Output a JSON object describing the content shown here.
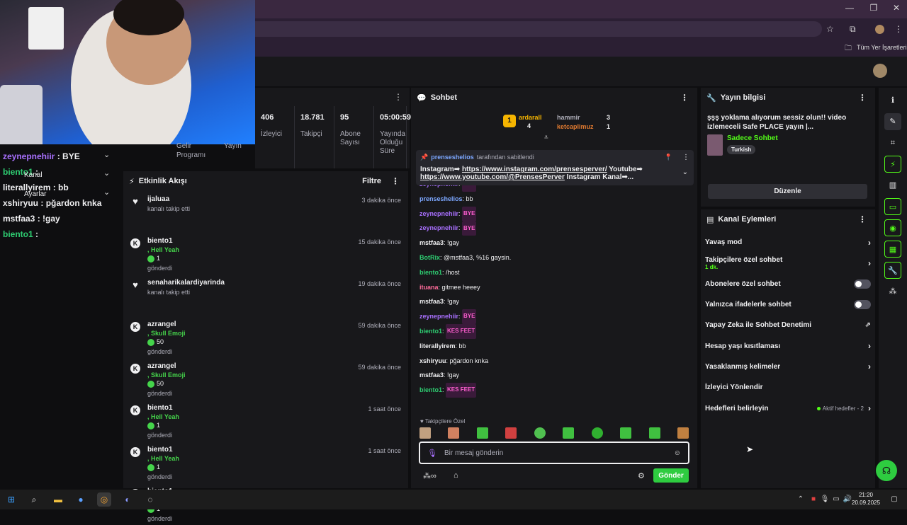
{
  "browser": {
    "bookmarks_label": "Tüm Yer İşaretleri"
  },
  "left_chat": [
    {
      "user": "zeynepnehiir",
      "msg": "BYE",
      "color": "#a970ff"
    },
    {
      "user": "biento1",
      "msg": "",
      "color": "#2ecc71"
    },
    {
      "user": "literallyirem",
      "msg": "bb",
      "color": "#efeff1"
    },
    {
      "user": "xshiryuu",
      "msg": "pğardon knka",
      "color": "#efeff1"
    },
    {
      "user": "mstfaa3",
      "msg": "!gay",
      "color": "#efeff1"
    },
    {
      "user": "biento1",
      "msg": "",
      "color": "#2ecc71"
    }
  ],
  "left_menu": {
    "kanal": "Kanal",
    "ayarlar": "Ayarlar"
  },
  "stats": [
    {
      "num": "",
      "label": "Gelir Programı"
    },
    {
      "num": "",
      "label": "Yayın"
    },
    {
      "num": "406",
      "label": "İzleyici"
    },
    {
      "num": "18.781",
      "label": "Takipçi"
    },
    {
      "num": "95",
      "label": "Abone Sayısı"
    },
    {
      "num": "05:00:59",
      "label": "Yayında Olduğu Süre"
    }
  ],
  "activity": {
    "title": "Etkinlik Akışı",
    "filter": "Filtre",
    "items": [
      {
        "icon": "heart",
        "name": "ijaluaa",
        "sub": "kanalı takip etti",
        "time": "3 dakika önce"
      },
      {
        "icon": "kick",
        "name": "biento1",
        "gift": ", Hell Yeah",
        "amount": "1",
        "sub": "gönderdi",
        "time": "15 dakika önce"
      },
      {
        "icon": "heart",
        "name": "senaharikalardiyarinda",
        "sub": "kanalı takip etti",
        "time": "19 dakika önce"
      },
      {
        "icon": "kick",
        "name": "azrangel",
        "gift": ", Skull Emoji",
        "amount": "50",
        "sub": "gönderdi",
        "time": "59 dakika önce"
      },
      {
        "icon": "kick",
        "name": "azrangel",
        "gift": ", Skull Emoji",
        "amount": "50",
        "sub": "gönderdi",
        "time": "59 dakika önce"
      },
      {
        "icon": "kick",
        "name": "biento1",
        "gift": ", Hell Yeah",
        "amount": "1",
        "sub": "gönderdi",
        "time": "1 saat önce"
      },
      {
        "icon": "kick",
        "name": "biento1",
        "gift": ", Hell Yeah",
        "amount": "1",
        "sub": "gönderdi",
        "time": "1 saat önce"
      },
      {
        "icon": "kick",
        "name": "biento1",
        "gift": ", Hell Yeah",
        "amount": "1",
        "sub": "gönderdi",
        "time": "1 saat önce"
      }
    ]
  },
  "chat": {
    "title": "Sohbet",
    "top_gifters": [
      {
        "rank": "1",
        "name": "ardarall",
        "count": "4"
      },
      {
        "rank": "2",
        "name": "hammir",
        "count": "3"
      },
      {
        "rank": "3",
        "name": "ketcaplimuz",
        "count": "1"
      }
    ],
    "pinned": {
      "user": "prenseshelios",
      "by": "tarafından sabitlendi",
      "line1_prefix": "Instagram➡",
      "link1": "https://www.instagram.com/prensesperver/",
      "line1_suffix": "Youtube➡",
      "link2": "https://www.youtube.com/@PrensesPerver",
      "line2_suffix": "Instagram Kanal➡..."
    },
    "messages": [
      {
        "user": "zeynepnehiir",
        "text": "BYE",
        "cls": "u-purple",
        "emote": true
      },
      {
        "user": "prenseshelios",
        "text": "bb",
        "cls": "u-blue"
      },
      {
        "user": "zeynepnehiir",
        "text": "BYE",
        "cls": "u-purple",
        "emote": true
      },
      {
        "user": "zeynepnehiir",
        "text": "BYE",
        "cls": "u-purple",
        "emote": true
      },
      {
        "user": "mstfaa3",
        "text": "!gay",
        "cls": "u-white"
      },
      {
        "user": "BotRix",
        "text": "@mstfaa3, %16 gaysin.",
        "cls": "u-green"
      },
      {
        "user": "biento1",
        "text": "/host",
        "cls": "u-green"
      },
      {
        "user": "ituana",
        "text": "gitmee heeey",
        "cls": "u-pink"
      },
      {
        "user": "mstfaa3",
        "text": "!gay",
        "cls": "u-white"
      },
      {
        "user": "zeynepnehiir",
        "text": "BYE",
        "cls": "u-purple",
        "emote": true
      },
      {
        "user": "biento1",
        "text": "KES FEET",
        "cls": "u-green",
        "emote": true
      },
      {
        "user": "literallyirem",
        "text": "bb",
        "cls": "u-white"
      },
      {
        "user": "xshiryuu",
        "text": "pğardon knka",
        "cls": "u-white"
      },
      {
        "user": "mstfaa3",
        "text": "!gay",
        "cls": "u-white"
      },
      {
        "user": "biento1",
        "text": "KES FEET",
        "cls": "u-green",
        "emote": true
      }
    ],
    "followers_only": "Takipçilere Özel",
    "input_placeholder": "Bir mesaj gönderin",
    "send_label": "Gönder"
  },
  "info": {
    "title": "Yayın bilgisi",
    "stream_title": "şşş yoklama alıyorum sessiz olun!! video izlemeceli Safe PLACE yayın |...",
    "category": "Sadece Sohbet",
    "language": "Turkish",
    "edit": "Düzenle"
  },
  "actions": {
    "title": "Kanal Eylemleri",
    "rows": [
      {
        "label": "Yavaş mod",
        "type": "chevron"
      },
      {
        "label": "Takipçilere özel sohbet",
        "sub": "1 dk.",
        "type": "chevron"
      },
      {
        "label": "Abonelere özel sohbet",
        "type": "toggle"
      },
      {
        "label": "Yalnızca ifadelerle sohbet",
        "type": "toggle"
      },
      {
        "label": "Yapay Zeka ile Sohbet Denetimi",
        "type": "external"
      },
      {
        "label": "Hesap yaşı kısıtlaması",
        "type": "chevron"
      },
      {
        "label": "Yasaklanmış kelimeler",
        "type": "chevron"
      },
      {
        "label": "İzleyici Yönlendir",
        "type": "none"
      },
      {
        "label": "Hedefleri belirleyin",
        "extra": "Aktif hedefler - 2",
        "type": "chevron"
      }
    ]
  },
  "taskbar": {
    "time": "21:20",
    "date": "20.09.2025"
  },
  "colors": {
    "accent": "#53fc18",
    "panel": "#18181b",
    "bg": "#0e0e10",
    "send": "#2ecc40"
  }
}
